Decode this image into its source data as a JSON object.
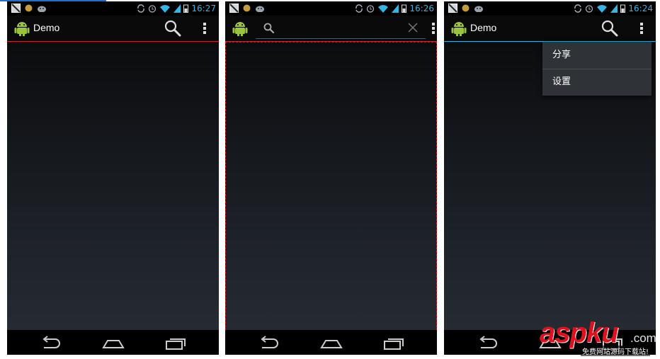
{
  "screens": [
    {
      "time": "16:27",
      "title": "Demo",
      "accent_line": "#c0272d"
    },
    {
      "time": "16:26",
      "search_placeholder": "",
      "accent_line": "#c0272d"
    },
    {
      "time": "16:24",
      "title": "Demo",
      "accent_line": "#33b5e5",
      "menu_items": [
        "分享",
        "设置"
      ]
    }
  ],
  "watermark": {
    "main": "aspku",
    "suffix": ".com",
    "subtitle": "免费网站源码下载站!"
  },
  "colors": {
    "status_time": "#33b5e5",
    "debug_dashes": "#e01010",
    "watermark_red": "#e0101d"
  }
}
